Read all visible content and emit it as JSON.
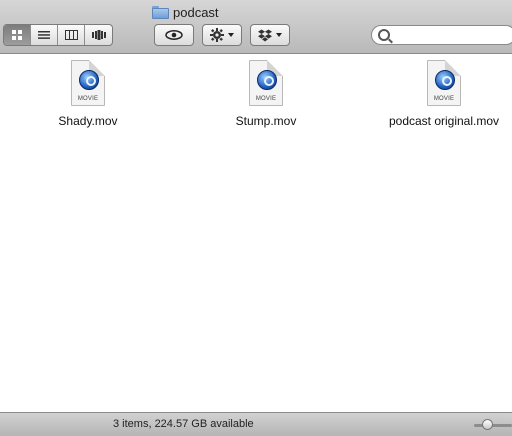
{
  "window": {
    "title": "podcast"
  },
  "toolbar": {
    "view_modes": [
      {
        "icon": "icon-view-icon",
        "active": true
      },
      {
        "icon": "list-view-icon",
        "active": false
      },
      {
        "icon": "column-view-icon",
        "active": false
      },
      {
        "icon": "coverflow-view-icon",
        "active": false
      }
    ],
    "quicklook_icon": "eye-icon",
    "action_icon": "gear-icon",
    "dropbox_icon": "dropbox-icon",
    "search": {
      "placeholder": "",
      "value": ""
    }
  },
  "files": [
    {
      "name": "Shady.mov",
      "kind_label": "MOVIE",
      "icon": "quicktime-movie-icon"
    },
    {
      "name": "Stump.mov",
      "kind_label": "MOVIE",
      "icon": "quicktime-movie-icon"
    },
    {
      "name": "podcast original.mov",
      "kind_label": "MOVIE",
      "icon": "quicktime-movie-icon"
    }
  ],
  "status": {
    "text": "3 items, 224.57 GB available"
  }
}
